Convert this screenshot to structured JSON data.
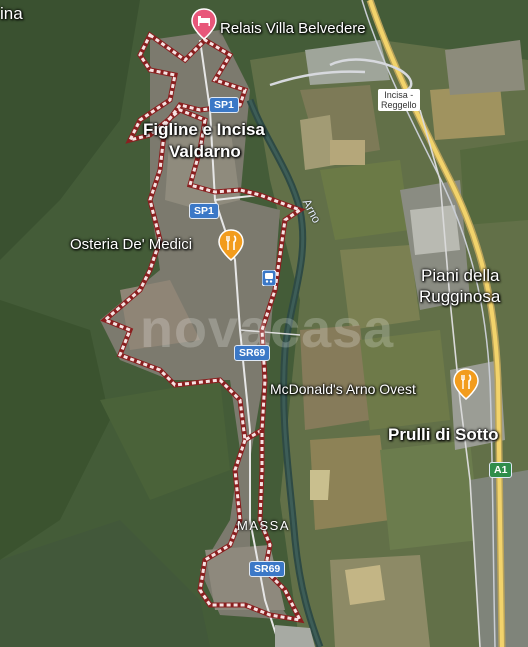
{
  "labels": {
    "partial_top_left": "ina",
    "relais": "Relais Villa Belvedere",
    "town_line1": "Figline e Incisa",
    "town_line2": "Valdarno",
    "osteria": "Osteria De' Medici",
    "piani_line1": "Piani della",
    "piani_line2": "Rugginosa",
    "mcdonalds": "McDonald's Arno Ovest",
    "prulli": "Prulli di Sotto",
    "massa": "MASSA",
    "river": "Arno",
    "exit_line1": "Incisa -",
    "exit_line2": "Reggello"
  },
  "roads": {
    "sp1_a": "SP1",
    "sp1_b": "SP1",
    "sr69_a": "SR69",
    "sr69_b": "SR69",
    "a1": "A1"
  },
  "watermark": "novacasa",
  "icons": {
    "hotel": "hotel-pin-icon",
    "restaurant1": "restaurant-pin-icon",
    "restaurant2": "restaurant-pin-icon",
    "train": "train-station-icon"
  },
  "colors": {
    "hotel_pin": "#e8577a",
    "restaurant_pin": "#f29c1d",
    "boundary": "#e45b5b",
    "motorway": "#f2d36b",
    "shield": "#3b78c7"
  }
}
